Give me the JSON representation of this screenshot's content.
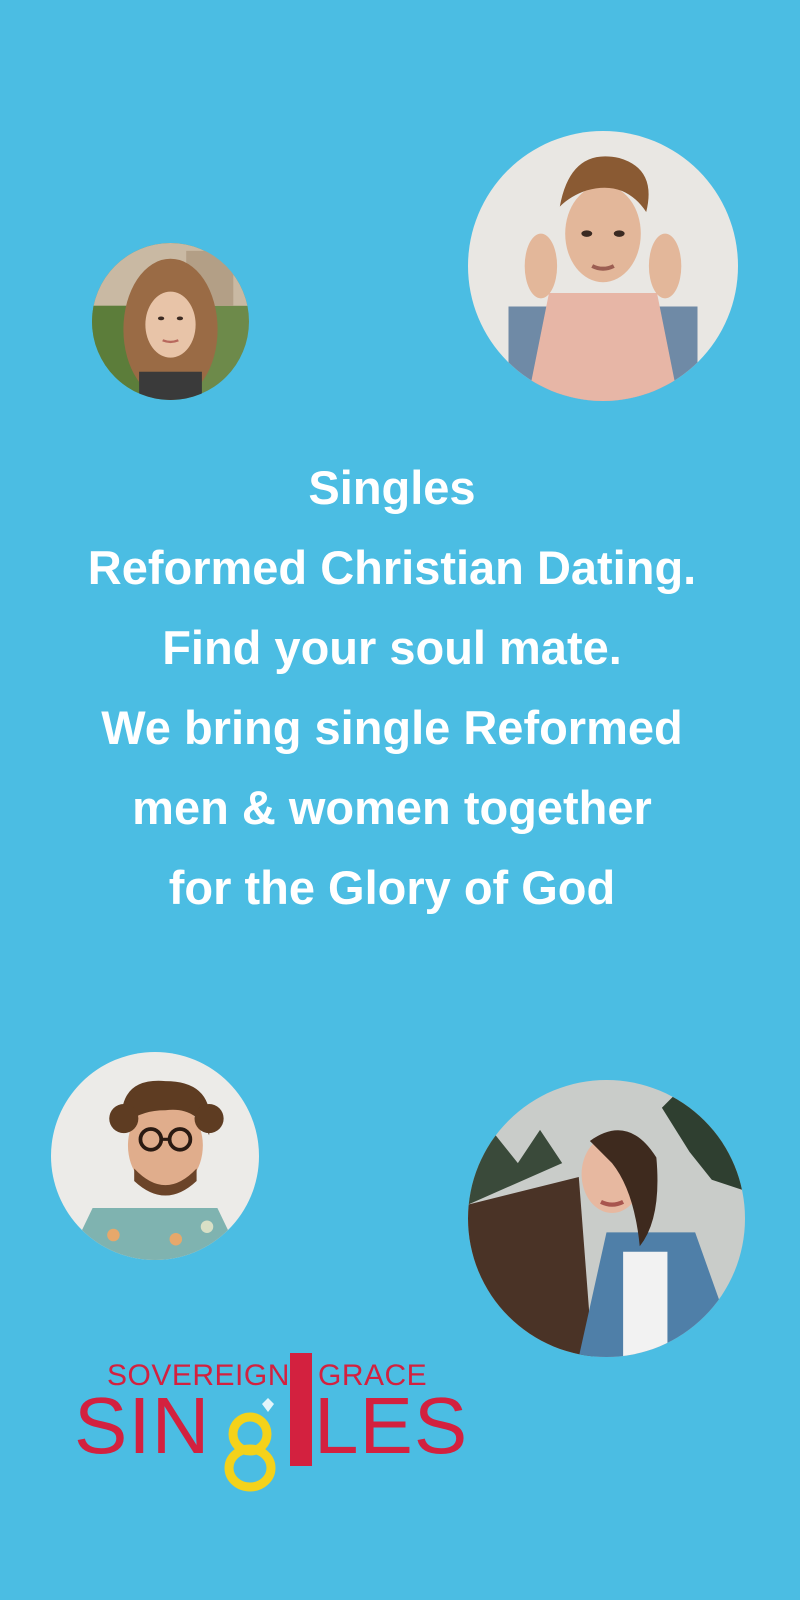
{
  "tagline": {
    "line1": "Singles",
    "line2": "Reformed Christian Dating.",
    "line3": "Find your soul mate.",
    "line4": "We bring single Reformed",
    "line5": "men & women together",
    "line6": "for the Glory of God"
  },
  "logo": {
    "top_left": "SOVEREIGN",
    "top_right": "GRACE",
    "big_left": "SIN",
    "big_right": "LES"
  },
  "colors": {
    "background": "#4bbde3",
    "text": "#ffffff",
    "logo_red": "#d3213f",
    "logo_yellow": "#f4d21a"
  },
  "avatars": [
    {
      "name": "avatar-woman-small",
      "icon": "profile-photo"
    },
    {
      "name": "avatar-man-hoodie",
      "icon": "profile-photo"
    },
    {
      "name": "avatar-man-glasses",
      "icon": "profile-photo"
    },
    {
      "name": "avatar-woman-hair",
      "icon": "profile-photo"
    }
  ]
}
